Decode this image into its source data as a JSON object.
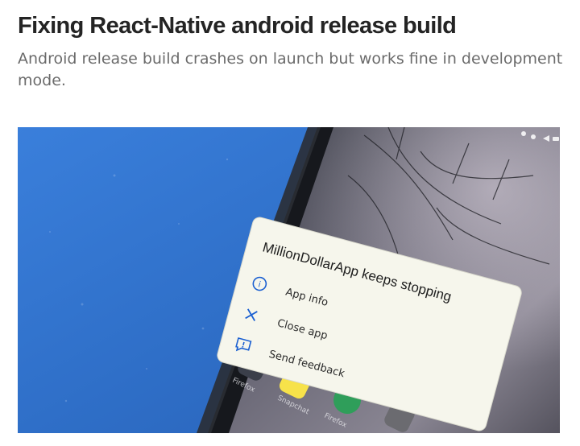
{
  "article": {
    "title": "Fixing React-Native android release build",
    "subtitle": "Android release build crashes on launch but works fine in development mode."
  },
  "crash_dialog": {
    "title": "MillionDollarApp keeps stopping",
    "options": [
      {
        "label": "App info",
        "icon": "info-circle-icon"
      },
      {
        "label": "Close app",
        "icon": "close-x-icon"
      },
      {
        "label": "Send feedback",
        "icon": "feedback-icon"
      }
    ]
  },
  "home_screen": {
    "app_labels": [
      "Firefox",
      "Snapchat",
      "Firefox"
    ]
  },
  "colors": {
    "title": "#242424",
    "subtitle": "#6b6b6b",
    "desk_blue": "#2f6fc8",
    "phone_body": "#16181d",
    "dialog_bg": "#f6f6ec",
    "dialog_accent": "#1a5fd1"
  }
}
